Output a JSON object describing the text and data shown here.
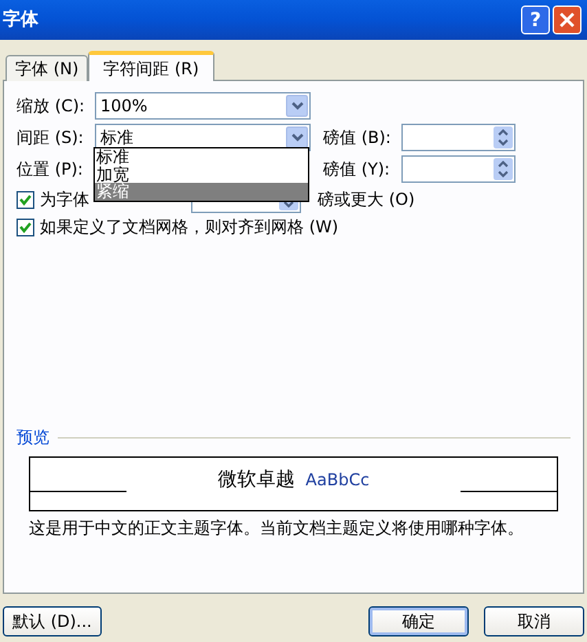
{
  "window": {
    "title": "字体",
    "help": "?"
  },
  "tabs": [
    {
      "label": "字体 (N)",
      "selected": false
    },
    {
      "label": "字符间距 (R)",
      "selected": true
    }
  ],
  "scale": {
    "label": "缩放 (C):",
    "value": "100%"
  },
  "spacing": {
    "label": "间距 (S):",
    "value": "标准"
  },
  "spacing_points": {
    "label": "磅值 (B):"
  },
  "position": {
    "label": "位置 (P):"
  },
  "position_points": {
    "label": "磅值 (Y):"
  },
  "spacing_options": [
    {
      "label": "标准",
      "selected": false
    },
    {
      "label": "加宽",
      "selected": false
    },
    {
      "label": "紧缩",
      "selected": true
    }
  ],
  "kerning": {
    "checked": true,
    "label": "为字体",
    "suffix": "磅或更大 (O)"
  },
  "grid": {
    "checked": true,
    "label": "如果定义了文档网格，则对齐到网格 (W)"
  },
  "preview": {
    "heading": "预览",
    "sample_cn": "微软卓越",
    "sample_en": "AaBbCc",
    "description": "这是用于中文的正文主题字体。当前文档主题定义将使用哪种字体。"
  },
  "buttons": [
    {
      "label": "默认 (D)...",
      "default": false
    },
    {
      "label": "确定",
      "default": true
    },
    {
      "label": "取消",
      "default": false
    }
  ]
}
